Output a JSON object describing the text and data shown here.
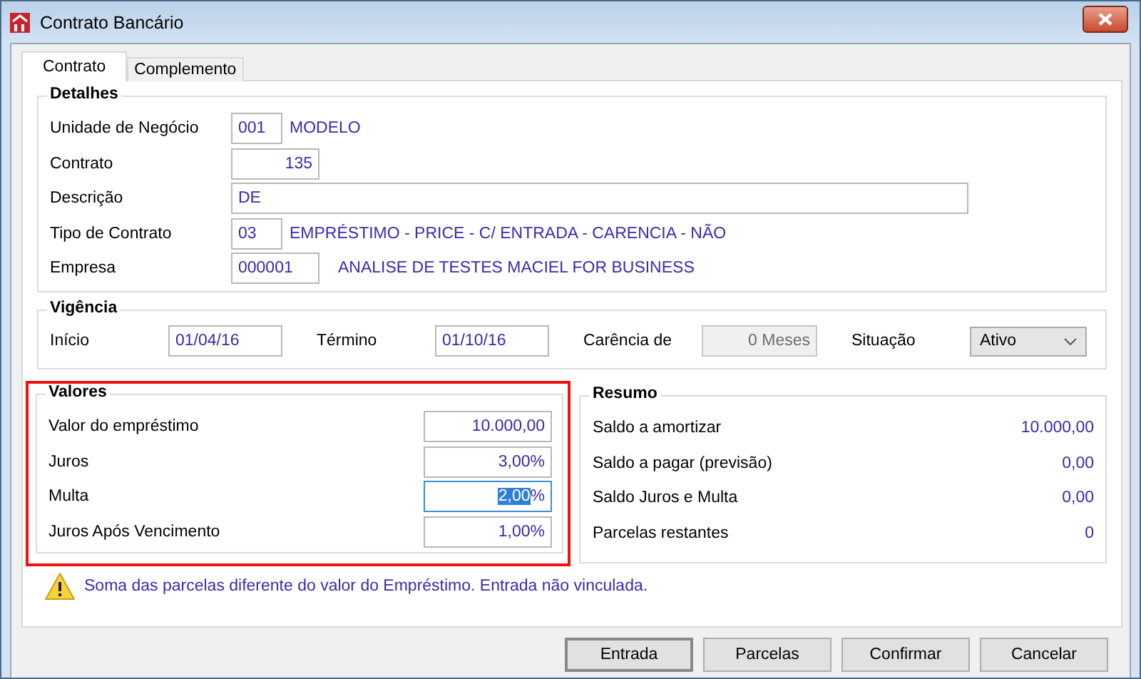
{
  "window": {
    "title": "Contrato Bancário"
  },
  "tabs": [
    {
      "label": "Contrato",
      "selected": true
    },
    {
      "label": "Complemento",
      "selected": false
    }
  ],
  "detalhes": {
    "title": "Detalhes",
    "rows": [
      {
        "label": "Unidade de Negócio",
        "kind": "code",
        "value": "001",
        "description": "MODELO"
      },
      {
        "label": "Contrato",
        "kind": "number",
        "value": "135"
      },
      {
        "label": "Descrição",
        "kind": "text",
        "value": "DE"
      },
      {
        "label": "Tipo de Contrato",
        "kind": "code",
        "value": "03",
        "description": "EMPRÉSTIMO - PRICE - C/ ENTRADA - CARENCIA - NÃO"
      },
      {
        "label": "Empresa",
        "kind": "id",
        "value": "000001",
        "description": "ANALISE DE TESTES MACIEL FOR BUSINESS"
      }
    ]
  },
  "vigencia": {
    "title": "Vigência",
    "fields": [
      {
        "label": "Início",
        "kind": "date",
        "value": "01/04/16",
        "disabled": false
      },
      {
        "label": "Término",
        "kind": "date",
        "value": "01/10/16",
        "disabled": false
      },
      {
        "label": "Carência de",
        "kind": "number",
        "value": "0 Meses",
        "disabled": true
      },
      {
        "label": "Situação",
        "kind": "select",
        "value": "Ativo"
      }
    ]
  },
  "valores": {
    "title": "Valores",
    "highlighted": true,
    "rows": [
      {
        "label": "Valor do empréstimo",
        "value": "10.000,00",
        "focused": false
      },
      {
        "label": "Juros",
        "value": "3,00%",
        "focused": false
      },
      {
        "label": "Multa",
        "value": "2,00",
        "suffix": "%",
        "focused": true
      },
      {
        "label": "Juros Após Vencimento",
        "value": "1,00%",
        "focused": false
      }
    ]
  },
  "resumo": {
    "title": "Resumo",
    "rows": [
      {
        "label": "Saldo a amortizar",
        "value": "10.000,00"
      },
      {
        "label": "Saldo a pagar (previsão)",
        "value": "0,00"
      },
      {
        "label": "Saldo Juros e Multa",
        "value": "0,00"
      },
      {
        "label": "Parcelas restantes",
        "value": "0"
      }
    ]
  },
  "warning": "Soma das parcelas diferente do valor do Empréstimo. Entrada não vinculada.",
  "buttons": [
    {
      "label": "Entrada",
      "default": true
    },
    {
      "label": "Parcelas",
      "default": false
    },
    {
      "label": "Confirmar",
      "default": false
    },
    {
      "label": "Cancelar",
      "default": false
    }
  ]
}
